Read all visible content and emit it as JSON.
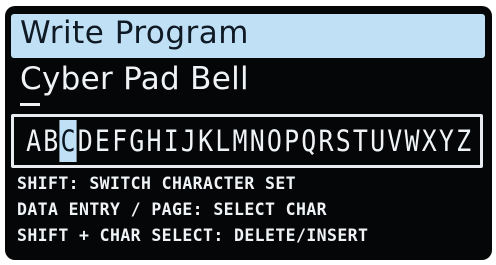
{
  "title": "Write Program",
  "program_name": "Cyber Pad Bell",
  "charset": {
    "characters": [
      "A",
      "B",
      "C",
      "D",
      "E",
      "F",
      "G",
      "H",
      "I",
      "J",
      "K",
      "L",
      "M",
      "N",
      "O",
      "P",
      "Q",
      "R",
      "S",
      "T",
      "U",
      "V",
      "W",
      "X",
      "Y",
      "Z"
    ],
    "selected_index": 2
  },
  "help": {
    "line1": "SHIFT: SWITCH CHARACTER SET",
    "line2": "DATA ENTRY / PAGE: SELECT CHAR",
    "line3": "SHIFT + CHAR SELECT: DELETE/INSERT"
  },
  "colors": {
    "screen_background": "#050607",
    "highlight": "#bfe0f5",
    "text": "#f0f3f6"
  }
}
